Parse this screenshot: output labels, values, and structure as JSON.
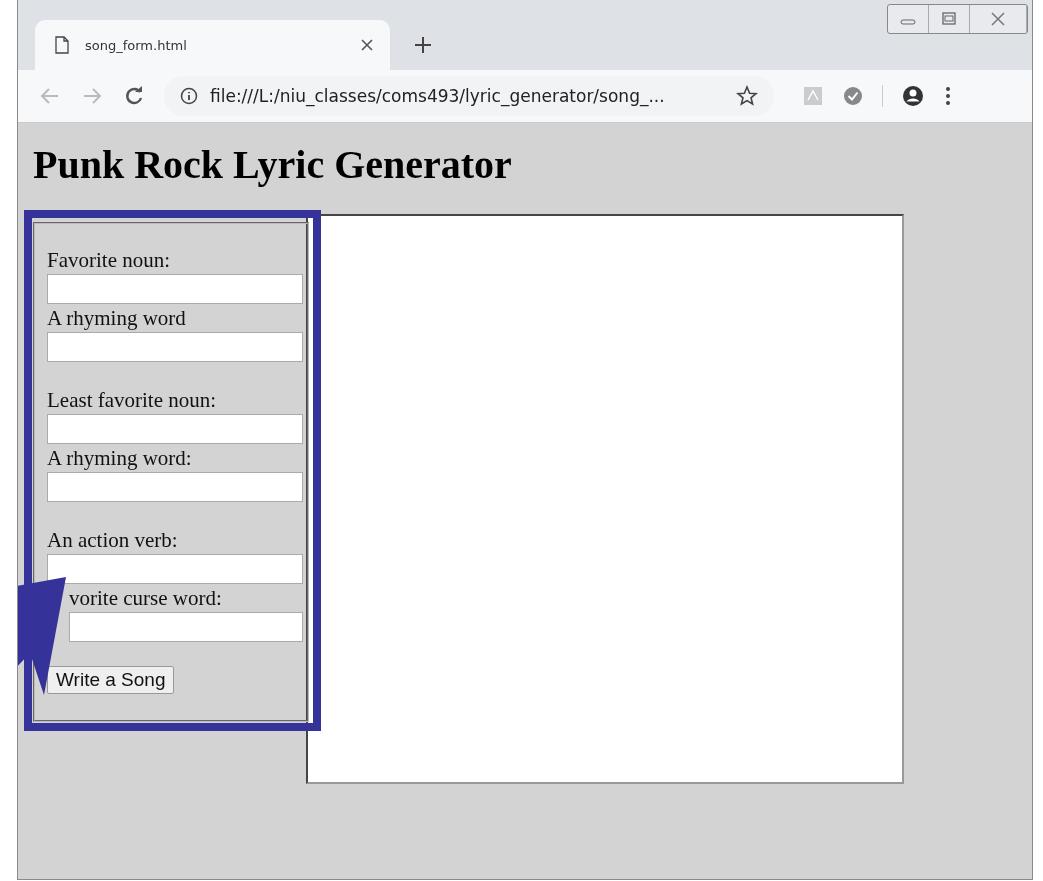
{
  "tab": {
    "title": "song_form.html",
    "selected": true
  },
  "address_bar": {
    "url": "file:///L:/niu_classes/coms493/lyric_generator/song_..."
  },
  "page": {
    "heading": "Punk Rock Lyric Generator",
    "form_groups": [
      {
        "fields": [
          {
            "label": "Favorite noun:"
          },
          {
            "label": "A rhyming word"
          }
        ]
      },
      {
        "fields": [
          {
            "label": "Least favorite noun:"
          },
          {
            "label": "A rhyming word:"
          }
        ]
      },
      {
        "fields": [
          {
            "label": "An action verb:"
          },
          {
            "label": "vorite curse word:",
            "covered": true
          }
        ]
      }
    ],
    "submit_button": "Write a Song"
  }
}
